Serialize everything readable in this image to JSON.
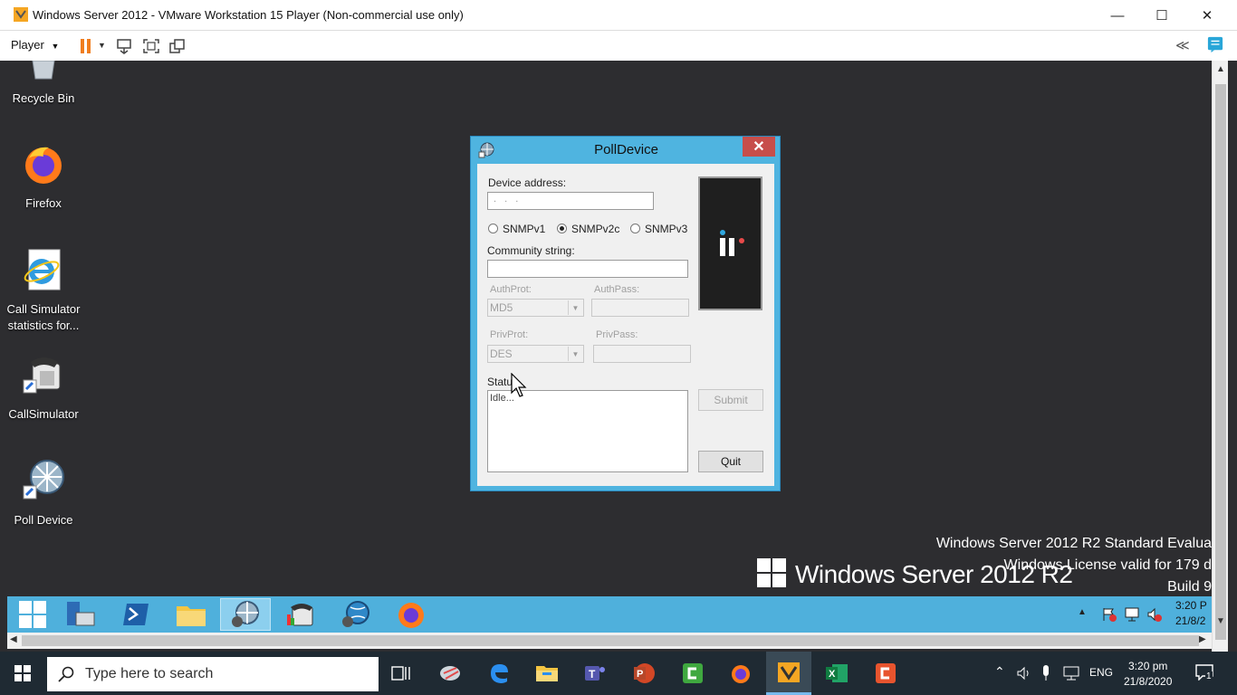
{
  "window": {
    "title": "Windows Server 2012 - VMware Workstation 15 Player (Non-commercial use only)",
    "minimize": "—",
    "maximize": "☐",
    "close": "✕"
  },
  "toolbar": {
    "player_menu": "Player",
    "collapse": "≪"
  },
  "desktop_icons": [
    {
      "label": "Recycle Bin",
      "icon": "recycle-bin-icon"
    },
    {
      "label": "Firefox",
      "icon": "firefox-icon"
    },
    {
      "label": "Call Simulator statistics for...",
      "icon": "internet-explorer-icon"
    },
    {
      "label": "CallSimulator",
      "icon": "phone-icon"
    },
    {
      "label": "Poll Device",
      "icon": "network-globe-icon"
    }
  ],
  "dialog": {
    "title": "PollDevice",
    "close": "✕",
    "device_address_label": "Device address:",
    "device_address_value": "   .   .   .",
    "snmp_options": [
      "SNMPv1",
      "SNMPv2c",
      "SNMPv3"
    ],
    "snmp_selected": "SNMPv2c",
    "community_label": "Community string:",
    "community_value": "",
    "authprot_label": "AuthProt:",
    "authprot_value": "MD5",
    "authpass_label": "AuthPass:",
    "privprot_label": "PrivProt:",
    "privprot_value": "DES",
    "privpass_label": "PrivPass:",
    "status_label": "Status",
    "status_value": "Idle...",
    "submit_label": "Submit",
    "quit_label": "Quit"
  },
  "watermark": {
    "line1": "Windows Server 2012 R2 Standard Evalua",
    "line2": "Windows License valid for 179 d",
    "line3": "Build 9",
    "brand": "Windows Server 2012 R2"
  },
  "guest_tray": {
    "time": "3:20 P",
    "date": "21/8/2"
  },
  "host_taskbar": {
    "search_placeholder": "Type here to search",
    "lang": "ENG",
    "time": "3:20 pm",
    "date": "21/8/2020",
    "notification_count": "1"
  }
}
